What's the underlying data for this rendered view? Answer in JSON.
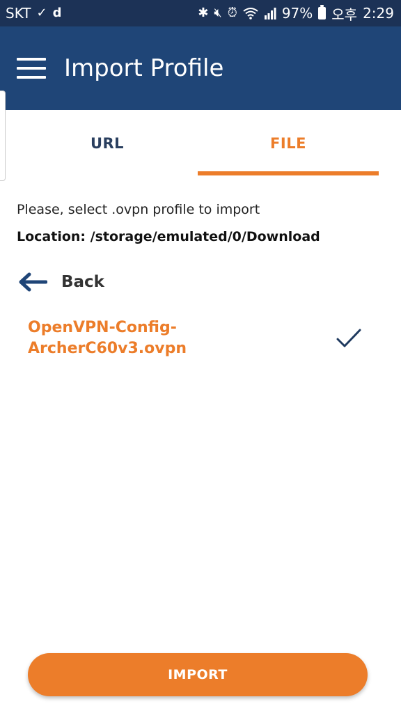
{
  "status_bar": {
    "carrier": "SKT",
    "battery": "97%",
    "ampm": "오후",
    "time": "2:29",
    "icons": [
      "check-download-icon",
      "d-app-icon",
      "bluetooth-icon",
      "mute-icon",
      "alarm-icon",
      "wifi-icon",
      "signal-icon",
      "battery-icon"
    ]
  },
  "app_bar": {
    "title": "Import Profile"
  },
  "tabs": [
    {
      "label": "URL",
      "active": false
    },
    {
      "label": "FILE",
      "active": true
    }
  ],
  "content": {
    "instruction": "Please, select .ovpn profile to import",
    "location": "Location: /storage/emulated/0/Download",
    "back_label": "Back",
    "files": [
      {
        "name": "OpenVPN-Config-ArcherC60v3.ovpn",
        "selected": true
      }
    ]
  },
  "import_button": {
    "label": "IMPORT"
  },
  "colors": {
    "status_bar": "#1c3256",
    "app_bar": "#1f4577",
    "accent": "#ec7d2a",
    "tab_inactive": "#2a3f5f"
  }
}
